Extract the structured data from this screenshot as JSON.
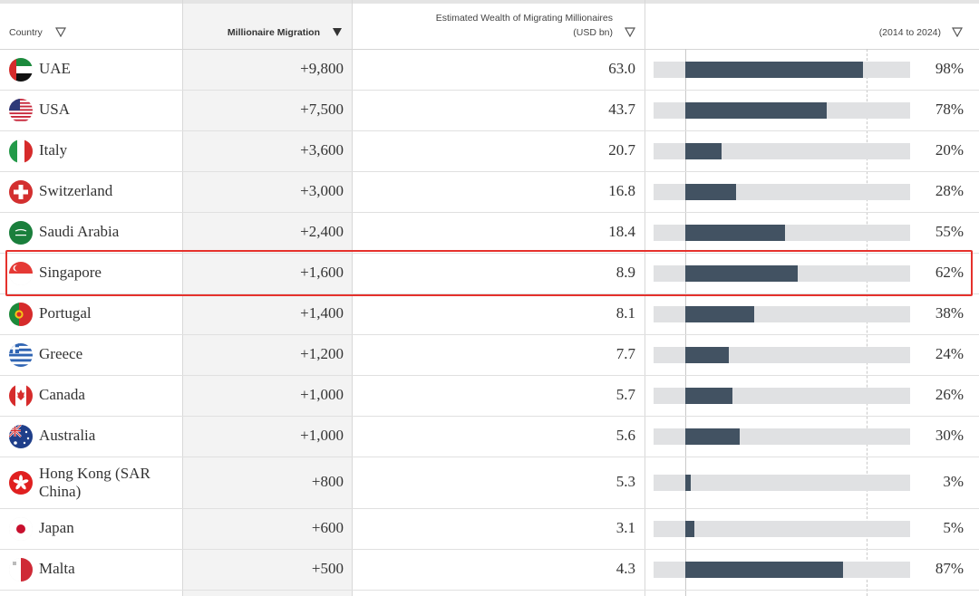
{
  "headers": {
    "country": "Country",
    "migration": "Millionaire Migration",
    "wealth_line1": "Estimated Wealth of Migrating Millionaires",
    "wealth_line2": "(USD bn)",
    "growth": "(2014 to 2024)"
  },
  "chart_data": {
    "type": "table",
    "columns": [
      "Country",
      "Millionaire Migration",
      "Estimated Wealth of Migrating Millionaires (USD bn)",
      "(2014 to 2024)"
    ],
    "sorted_by": "Millionaire Migration",
    "highlighted_row": "Singapore",
    "rows": [
      {
        "country": "UAE",
        "migration": "+9,800",
        "wealth": "63.0",
        "growth": 98,
        "growth_label": "98%",
        "flag": "uae"
      },
      {
        "country": "USA",
        "migration": "+7,500",
        "wealth": "43.7",
        "growth": 78,
        "growth_label": "78%",
        "flag": "usa"
      },
      {
        "country": "Italy",
        "migration": "+3,600",
        "wealth": "20.7",
        "growth": 20,
        "growth_label": "20%",
        "flag": "italy"
      },
      {
        "country": "Switzerland",
        "migration": "+3,000",
        "wealth": "16.8",
        "growth": 28,
        "growth_label": "28%",
        "flag": "switzerland"
      },
      {
        "country": "Saudi Arabia",
        "migration": "+2,400",
        "wealth": "18.4",
        "growth": 55,
        "growth_label": "55%",
        "flag": "saudi"
      },
      {
        "country": "Singapore",
        "migration": "+1,600",
        "wealth": "8.9",
        "growth": 62,
        "growth_label": "62%",
        "flag": "singapore"
      },
      {
        "country": "Portugal",
        "migration": "+1,400",
        "wealth": "8.1",
        "growth": 38,
        "growth_label": "38%",
        "flag": "portugal"
      },
      {
        "country": "Greece",
        "migration": "+1,200",
        "wealth": "7.7",
        "growth": 24,
        "growth_label": "24%",
        "flag": "greece"
      },
      {
        "country": "Canada",
        "migration": "+1,000",
        "wealth": "5.7",
        "growth": 26,
        "growth_label": "26%",
        "flag": "canada"
      },
      {
        "country": "Australia",
        "migration": "+1,000",
        "wealth": "5.6",
        "growth": 30,
        "growth_label": "30%",
        "flag": "australia"
      },
      {
        "country": "Hong Kong (SAR China)",
        "migration": "+800",
        "wealth": "5.3",
        "growth": 3,
        "growth_label": "3%",
        "flag": "hongkong"
      },
      {
        "country": "Japan",
        "migration": "+600",
        "wealth": "3.1",
        "growth": 5,
        "growth_label": "5%",
        "flag": "japan"
      },
      {
        "country": "Malta",
        "migration": "+500",
        "wealth": "4.3",
        "growth": 87,
        "growth_label": "87%",
        "flag": "malta"
      }
    ]
  }
}
